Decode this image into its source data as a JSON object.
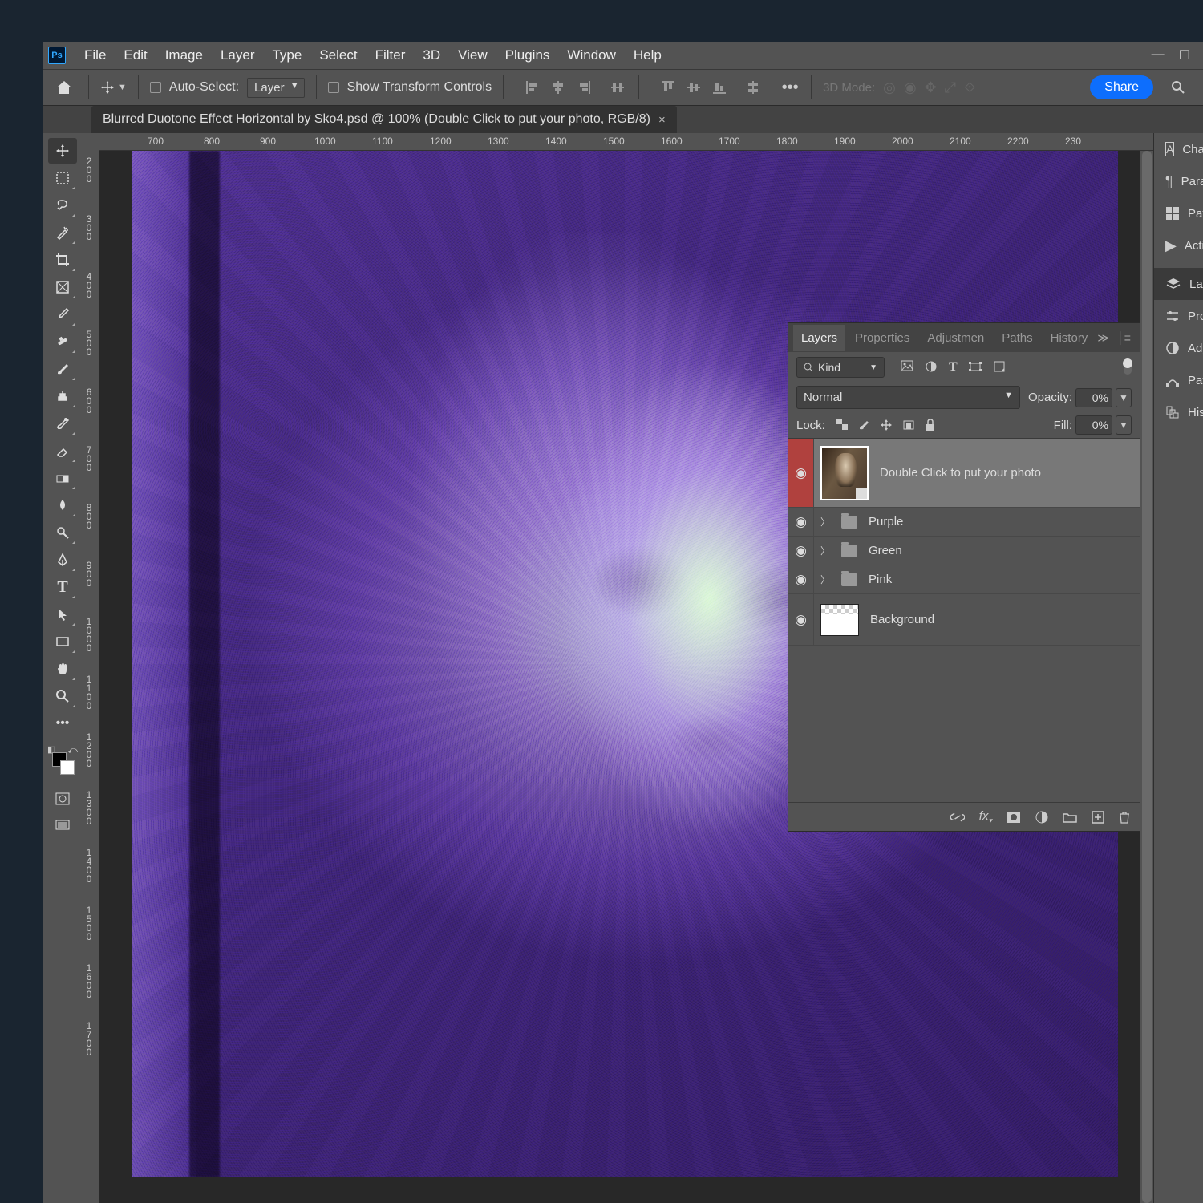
{
  "menu": [
    "File",
    "Edit",
    "Image",
    "Layer",
    "Type",
    "Select",
    "Filter",
    "3D",
    "View",
    "Plugins",
    "Window",
    "Help"
  ],
  "options": {
    "auto_select_label": "Auto-Select:",
    "target_select": "Layer",
    "transform_label": "Show Transform Controls",
    "mode3d_label": "3D Mode:",
    "share": "Share"
  },
  "document": {
    "tab_title": "Blurred Duotone Effect Horizontal by Sko4.psd @ 100% (Double Click to put your photo, RGB/8)"
  },
  "ruler_h": [
    "700",
    "800",
    "900",
    "1000",
    "1100",
    "1200",
    "1300",
    "1400",
    "1500",
    "1600",
    "1700",
    "1800",
    "1900",
    "2000",
    "2100",
    "2200",
    "230"
  ],
  "ruler_v": [
    "200",
    "300",
    "400",
    "500",
    "600",
    "700",
    "800",
    "900",
    "1000",
    "1100",
    "1200",
    "1300",
    "1400",
    "1500",
    "1600",
    "1700"
  ],
  "layers_panel": {
    "tabs": [
      "Layers",
      "Properties",
      "Adjustmen",
      "Paths",
      "History"
    ],
    "filter_kind": "Kind",
    "blend_mode": "Normal",
    "opacity_label": "Opacity:",
    "opacity_value": "0%",
    "lock_label": "Lock:",
    "fill_label": "Fill:",
    "fill_value": "0%",
    "layers": [
      {
        "name": "Double Click to put your photo"
      },
      {
        "name": "Purple"
      },
      {
        "name": "Green"
      },
      {
        "name": "Pink"
      },
      {
        "name": "Background"
      }
    ]
  },
  "right_panels_top": [
    "Chara",
    "Parag",
    "Patte",
    "Actio"
  ],
  "right_panels_mid": [
    "Layer",
    "Prop",
    "Adju",
    "Paths",
    "Histo"
  ]
}
